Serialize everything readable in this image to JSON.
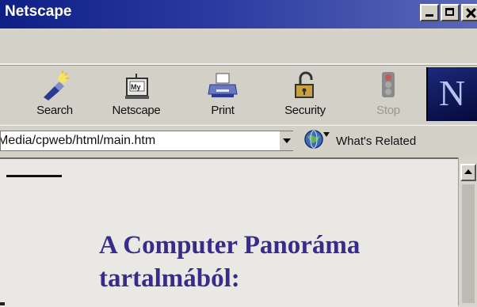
{
  "window": {
    "title": "Netscape",
    "accent": "#0e1f86"
  },
  "toolbar": {
    "buttons": [
      {
        "label": "Search",
        "icon": "flashlight-icon",
        "enabled": true
      },
      {
        "label": "Netscape",
        "icon": "my-netscape-icon",
        "enabled": true
      },
      {
        "label": "Print",
        "icon": "printer-icon",
        "enabled": true
      },
      {
        "label": "Security",
        "icon": "padlock-icon",
        "enabled": true
      },
      {
        "label": "Stop",
        "icon": "stop-icon",
        "enabled": false
      }
    ],
    "logo": "N"
  },
  "location": {
    "url": "Media/cpweb/html/main.htm",
    "related_label": "What's Related"
  },
  "content": {
    "heading_line1": "A Computer Panoráma",
    "heading_line2": "tartalmából:",
    "heading_color": "#3a2b8a"
  }
}
